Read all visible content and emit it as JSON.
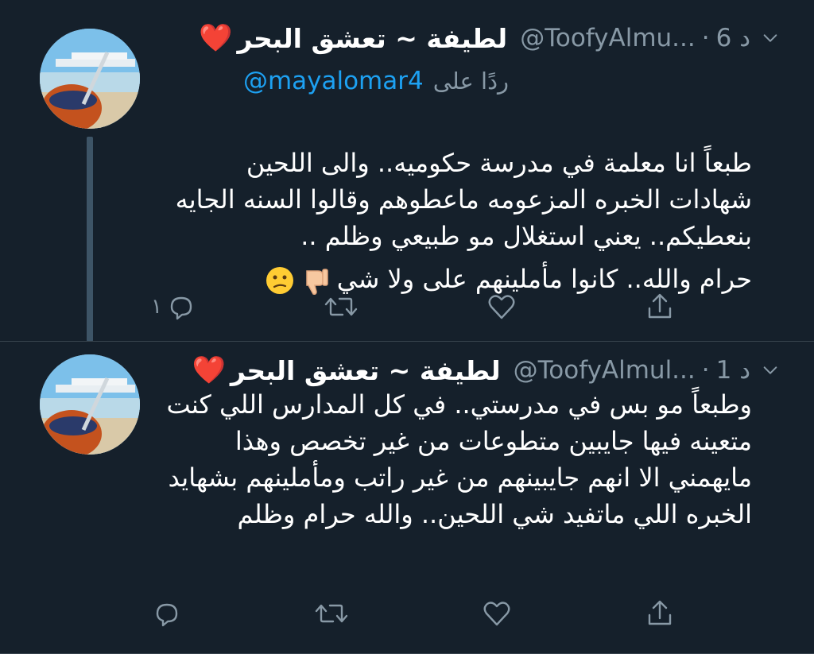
{
  "tweets": [
    {
      "name": "لطيفة ~ تعشق البحر",
      "heart": "❤️",
      "handle": "@ToofyAlmu...",
      "dot": "·",
      "time": "6 د",
      "reply_label": "ردًا على",
      "reply_handle": "@mayalomar4",
      "body": "طبعاً انا معلمة في مدرسة حكوميه.. والى اللحين شهادات الخبره المزعومه ماعطوهم وقالوا السنه الجايه بنعطيكم.. يعني استغلال مو طبيعي وظلم ..",
      "body2": "حرام والله.. كانوا مأملينهم على ولا شي",
      "reply_count": "١"
    },
    {
      "name": "لطيفة ~ تعشق البحر",
      "heart": "❤️",
      "handle": "@ToofyAlmul...",
      "dot": "·",
      "time": "1 د",
      "body": "وطبعاً مو بس في مدرستي.. في كل المدارس اللي كنت متعينه فيها جايبين متطوعات من غير تخصص وهذا مايهمني الا انهم جايبينهم من غير راتب ومأملينهم بشهايد الخبره اللي ماتفيد شي اللحين.. والله حرام وظلم"
    }
  ],
  "icons": {
    "reply": "speech-bubble-icon",
    "retweet": "retweet-icon",
    "like": "heart-outline-icon",
    "share": "share-icon",
    "more": "chevron-down-icon",
    "emoji1": "thumbs-down-emoji",
    "emoji2": "confused-face-emoji"
  },
  "colors": {
    "background": "#15202b",
    "muted": "#8899a6",
    "link": "#1da1f2"
  }
}
